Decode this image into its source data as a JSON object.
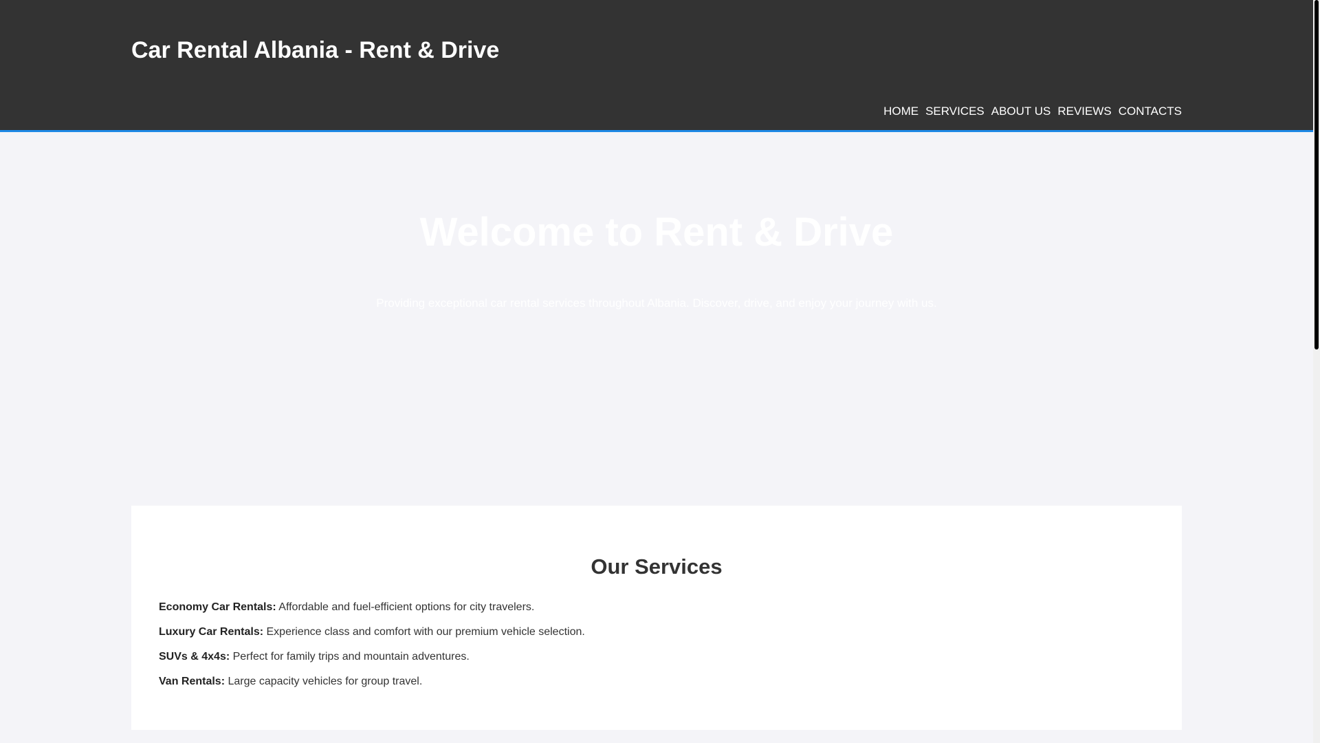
{
  "header": {
    "title": "Car Rental Albania - Rent & Drive",
    "nav": [
      "HOME",
      "SERVICES",
      "ABOUT US",
      "REVIEWS",
      "CONTACTS"
    ]
  },
  "hero": {
    "title": "Welcome to Rent & Drive",
    "subtitle": "Providing exceptional car rental services throughout Albania. Discover, drive, and enjoy your journey with us."
  },
  "services": {
    "heading": "Our Services",
    "items": [
      {
        "name": "Economy Car Rentals:",
        "description": " Affordable and fuel-efficient options for city travelers."
      },
      {
        "name": "Luxury Car Rentals:",
        "description": " Experience class and comfort with our premium vehicle selection."
      },
      {
        "name": "SUVs & 4x4s:",
        "description": " Perfect for family trips and mountain adventures."
      },
      {
        "name": "Van Rentals:",
        "description": " Large capacity vehicles for group travel."
      }
    ]
  },
  "colors": {
    "header_bg": "#333333",
    "accent": "#1e88e5",
    "page_bg": "#f4f4f8",
    "card_bg": "#ffffff"
  }
}
